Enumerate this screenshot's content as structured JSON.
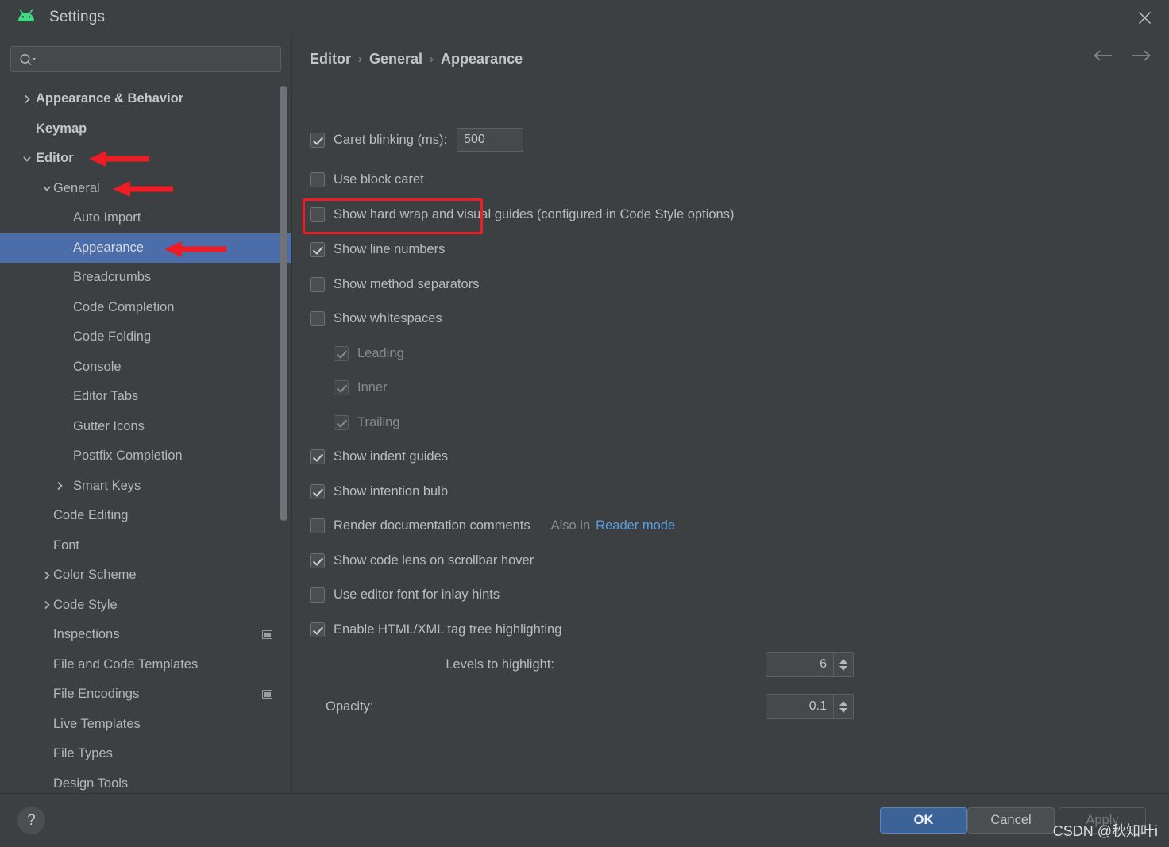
{
  "window": {
    "title": "Settings",
    "logo_icon": "android-logo-icon",
    "close_icon": "close-icon"
  },
  "search": {
    "value": "",
    "placeholder": "",
    "icon": "search-icon"
  },
  "sidebar": {
    "items": [
      {
        "label": "Appearance & Behavior",
        "indent": 0,
        "twisty": "chevron-right-icon",
        "bold": true,
        "selected": false,
        "scope_icon": false
      },
      {
        "label": "Keymap",
        "indent": 0,
        "twisty": "",
        "bold": true,
        "selected": false,
        "scope_icon": false
      },
      {
        "label": "Editor",
        "indent": 0,
        "twisty": "chevron-down-icon",
        "bold": true,
        "selected": false,
        "scope_icon": false
      },
      {
        "label": "General",
        "indent": 1,
        "twisty": "chevron-down-icon",
        "bold": false,
        "selected": false,
        "scope_icon": false
      },
      {
        "label": "Auto Import",
        "indent": 2,
        "twisty": "",
        "bold": false,
        "selected": false,
        "scope_icon": false
      },
      {
        "label": "Appearance",
        "indent": 2,
        "twisty": "",
        "bold": false,
        "selected": true,
        "scope_icon": false
      },
      {
        "label": "Breadcrumbs",
        "indent": 2,
        "twisty": "",
        "bold": false,
        "selected": false,
        "scope_icon": false
      },
      {
        "label": "Code Completion",
        "indent": 2,
        "twisty": "",
        "bold": false,
        "selected": false,
        "scope_icon": false
      },
      {
        "label": "Code Folding",
        "indent": 2,
        "twisty": "",
        "bold": false,
        "selected": false,
        "scope_icon": false
      },
      {
        "label": "Console",
        "indent": 2,
        "twisty": "",
        "bold": false,
        "selected": false,
        "scope_icon": false
      },
      {
        "label": "Editor Tabs",
        "indent": 2,
        "twisty": "",
        "bold": false,
        "selected": false,
        "scope_icon": false
      },
      {
        "label": "Gutter Icons",
        "indent": 2,
        "twisty": "",
        "bold": false,
        "selected": false,
        "scope_icon": false
      },
      {
        "label": "Postfix Completion",
        "indent": 2,
        "twisty": "",
        "bold": false,
        "selected": false,
        "scope_icon": false
      },
      {
        "label": "Smart Keys",
        "indent": 2,
        "twisty": "chevron-right-icon",
        "bold": false,
        "selected": false,
        "scope_icon": false
      },
      {
        "label": "Code Editing",
        "indent": 1,
        "twisty": "",
        "bold": false,
        "selected": false,
        "scope_icon": false
      },
      {
        "label": "Font",
        "indent": 1,
        "twisty": "",
        "bold": false,
        "selected": false,
        "scope_icon": false
      },
      {
        "label": "Color Scheme",
        "indent": 1,
        "twisty": "chevron-right-icon",
        "bold": false,
        "selected": false,
        "scope_icon": false
      },
      {
        "label": "Code Style",
        "indent": 1,
        "twisty": "chevron-right-icon",
        "bold": false,
        "selected": false,
        "scope_icon": false
      },
      {
        "label": "Inspections",
        "indent": 1,
        "twisty": "",
        "bold": false,
        "selected": false,
        "scope_icon": true
      },
      {
        "label": "File and Code Templates",
        "indent": 1,
        "twisty": "",
        "bold": false,
        "selected": false,
        "scope_icon": false
      },
      {
        "label": "File Encodings",
        "indent": 1,
        "twisty": "",
        "bold": false,
        "selected": false,
        "scope_icon": true
      },
      {
        "label": "Live Templates",
        "indent": 1,
        "twisty": "",
        "bold": false,
        "selected": false,
        "scope_icon": false
      },
      {
        "label": "File Types",
        "indent": 1,
        "twisty": "",
        "bold": false,
        "selected": false,
        "scope_icon": false
      },
      {
        "label": "Design Tools",
        "indent": 1,
        "twisty": "",
        "bold": false,
        "selected": false,
        "scope_icon": false
      }
    ]
  },
  "breadcrumb": {
    "items": [
      "Editor",
      "General",
      "Appearance"
    ],
    "separator": "›",
    "back_icon": "arrow-left-icon",
    "forward_icon": "arrow-right-icon"
  },
  "settings": {
    "caret_blinking": {
      "label": "Caret blinking (ms):",
      "checked": true,
      "value": "500"
    },
    "use_block_caret": {
      "label": "Use block caret",
      "checked": false
    },
    "show_hard_wrap": {
      "label": "Show hard wrap and visual guides (configured in Code Style options)",
      "checked": false
    },
    "show_line_numbers": {
      "label": "Show line numbers",
      "checked": true,
      "highlighted": true
    },
    "show_method_separators": {
      "label": "Show method separators",
      "checked": false
    },
    "show_whitespaces": {
      "label": "Show whitespaces",
      "checked": false
    },
    "whitespace_leading": {
      "label": "Leading",
      "checked": true,
      "disabled": true
    },
    "whitespace_inner": {
      "label": "Inner",
      "checked": true,
      "disabled": true
    },
    "whitespace_trailing": {
      "label": "Trailing",
      "checked": true,
      "disabled": true
    },
    "show_indent_guides": {
      "label": "Show indent guides",
      "checked": true
    },
    "show_intention_bulb": {
      "label": "Show intention bulb",
      "checked": true
    },
    "render_doc_comments": {
      "label": "Render documentation comments",
      "checked": false,
      "also_in": "Also in",
      "link": "Reader mode"
    },
    "show_code_lens": {
      "label": "Show code lens on scrollbar hover",
      "checked": true
    },
    "use_editor_font_inlay": {
      "label": "Use editor font for inlay hints",
      "checked": false
    },
    "enable_tag_tree": {
      "label": "Enable HTML/XML tag tree highlighting",
      "checked": true
    },
    "levels_to_highlight": {
      "label": "Levels to highlight:",
      "value": "6"
    },
    "opacity": {
      "label": "Opacity:",
      "value": "0.1"
    }
  },
  "footer": {
    "help_label": "?",
    "ok_label": "OK",
    "cancel_label": "Cancel",
    "apply_label": "Apply"
  },
  "watermark": {
    "text": "CSDN @秋知叶i"
  },
  "colors": {
    "selection_blue": "#4b6eab",
    "link_blue": "#5c9ede",
    "annotation_red": "#ee1c25",
    "ok_button_blue": "#3c6398",
    "android_green": "#3ddc84"
  }
}
